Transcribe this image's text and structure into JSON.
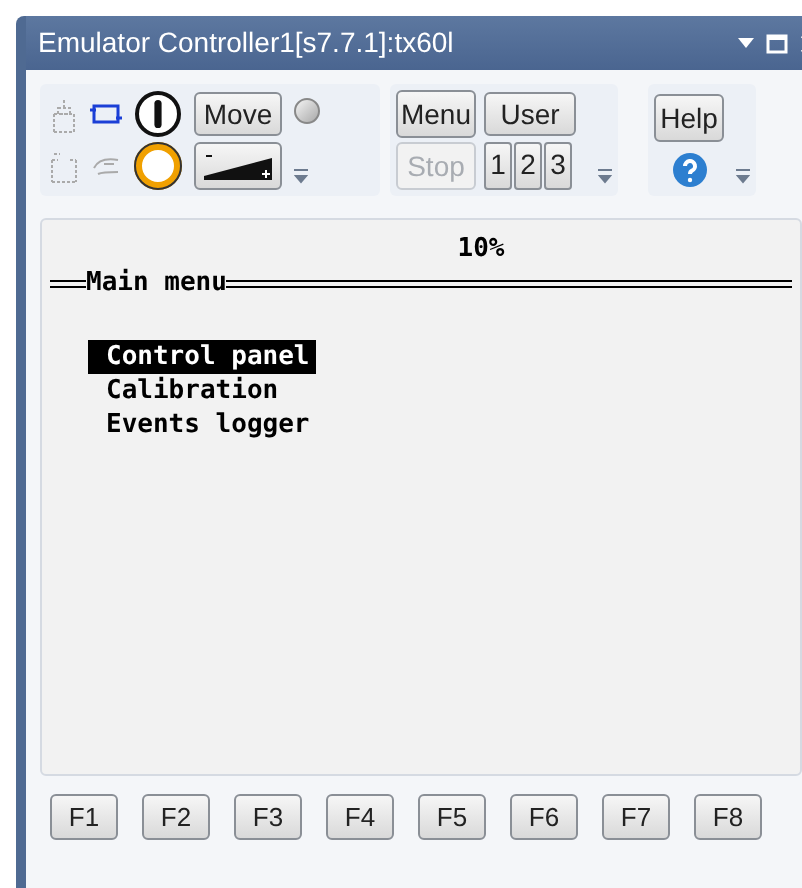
{
  "window": {
    "title": "Emulator Controller1[s7.7.1]:tx60l"
  },
  "toolbar": {
    "move": {
      "label": "Move",
      "disabled": false
    },
    "menu": {
      "label": "Menu",
      "disabled": false
    },
    "user": {
      "label": "User",
      "disabled": false
    },
    "stop": {
      "label": "Stop",
      "disabled": true
    },
    "numbers": [
      {
        "label": "1"
      },
      {
        "label": "2"
      },
      {
        "label": "3"
      }
    ],
    "help": {
      "label": "Help",
      "disabled": false
    }
  },
  "screen": {
    "progress": "10%",
    "heading": "Main menu",
    "items": [
      {
        "label": "Control panel",
        "selected": true
      },
      {
        "label": "Calibration",
        "selected": false
      },
      {
        "label": "Events logger",
        "selected": false
      }
    ]
  },
  "function_keys": [
    {
      "label": "F1"
    },
    {
      "label": "F2"
    },
    {
      "label": "F3"
    },
    {
      "label": "F4"
    },
    {
      "label": "F5"
    },
    {
      "label": "F6"
    },
    {
      "label": "F7"
    },
    {
      "label": "F8"
    }
  ]
}
